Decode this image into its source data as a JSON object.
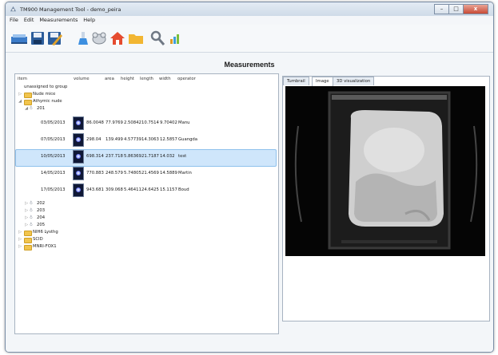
{
  "window": {
    "title": "TM900 Management Tool - demo_peira",
    "minimize": "–",
    "maximize": "□",
    "close": "x"
  },
  "menu": [
    "File",
    "Edit",
    "Measurements",
    "Help"
  ],
  "toolbar": [
    {
      "icon": "database-icon"
    },
    {
      "icon": "save-icon"
    },
    {
      "icon": "edit-save-icon"
    },
    {
      "icon": "flask-icon"
    },
    {
      "icon": "mouse-icon"
    },
    {
      "icon": "home-icon"
    },
    {
      "icon": "folder-icon"
    },
    {
      "icon": "tools-icon"
    },
    {
      "icon": "bar-chart-icon"
    }
  ],
  "main": {
    "heading": "Measurements",
    "columns": [
      "item",
      "volume",
      "area",
      "height",
      "length",
      "width",
      "operator"
    ],
    "tree": {
      "unassigned": "unassigned to group",
      "nude_mice": "Nude mice",
      "athymic": "Athymic nude",
      "animal_201": "201",
      "rows": [
        {
          "date": "03/05/2013",
          "volume": "86.0048",
          "area": "77.9769",
          "height": "2.50842",
          "length": "10.7514",
          "width": "9.70402",
          "operator": "Manu"
        },
        {
          "date": "07/05/2013",
          "volume": "298.04",
          "area": "139.499",
          "height": "4.57739",
          "length": "14.3063",
          "width": "12.5857",
          "operator": "Guangda"
        },
        {
          "date": "10/05/2013",
          "volume": "698.314",
          "area": "237.718",
          "height": "5.86369",
          "length": "21.7187",
          "width": "14.032",
          "operator": "test"
        },
        {
          "date": "14/05/2013",
          "volume": "770.883",
          "area": "248.579",
          "height": "5.74805",
          "length": "21.4569",
          "width": "14.5889",
          "operator": "Martin"
        },
        {
          "date": "17/05/2013",
          "volume": "943.681",
          "area": "309.068",
          "height": "5.46411",
          "length": "24.6425",
          "width": "15.1157",
          "operator": "Boud"
        }
      ],
      "animals": [
        "202",
        "203",
        "204",
        "205"
      ],
      "groups": [
        "NIH6 Lysthg",
        "SCID",
        "MNRI-FOX1"
      ]
    },
    "tabs": [
      "Tumbrail",
      "Image",
      "3D visualization"
    ],
    "active_tab": "Image"
  }
}
